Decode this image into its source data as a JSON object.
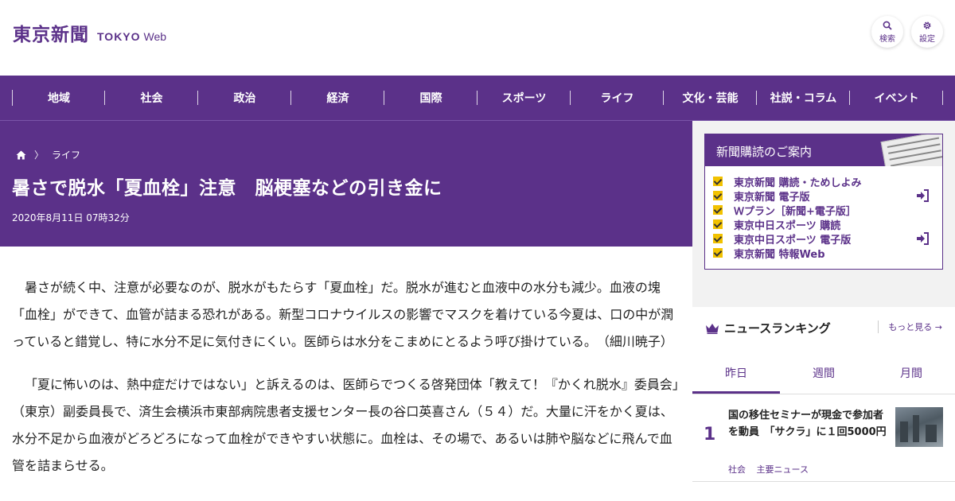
{
  "header": {
    "logo_jp": "東京新聞",
    "logo_en": "TOKYO",
    "logo_web": "Web",
    "search_label": "検索",
    "settings_label": "設定"
  },
  "nav": {
    "items": [
      "地域",
      "社会",
      "政治",
      "経済",
      "国際",
      "スポーツ",
      "ライフ",
      "文化・芸能",
      "社説・コラム",
      "イベント"
    ]
  },
  "article": {
    "breadcrumb": "ライフ",
    "title": "暑さで脱水「夏血栓」注意　脳梗塞などの引き金に",
    "date": "2020年8月11日 07時32分",
    "paragraphs": [
      "暑さが続く中、注意が必要なのが、脱水がもたらす「夏血栓」だ。脱水が進むと血液中の水分も減少。血液の塊「血栓」ができて、血管が詰まる恐れがある。新型コロナウイルスの影響でマスクを着けている今夏は、口の中が潤っていると錯覚し、特に水分不足に気付きにくい。医師らは水分をこまめにとるよう呼び掛けている。　（細川暁子）",
      "「夏に怖いのは、熱中症だけではない」と訴えるのは、医師らでつくる啓発団体「教えて！『かくれ脱水』委員会」（東京）副委員長で、済生会横浜市東部病院患者支援センター長の谷口英喜さん（５４）だ。大量に汗をかく夏は、水分不足から血液がどろどろになって血栓ができやすい状態に。血栓は、その場で、あるいは肺や脳などに飛んで血管を詰まらせる。"
    ]
  },
  "subscription": {
    "title": "新聞購読のご案内",
    "items": [
      "東京新聞 購読・ためしよみ",
      "東京新聞 電子版",
      "Ｗプラン［新聞+電子版］",
      "東京中日スポーツ 購読",
      "東京中日スポーツ 電子版",
      "東京新聞 特報Web"
    ]
  },
  "ranking": {
    "title": "ニュースランキング",
    "more_label": "もっと見る",
    "tabs": [
      "昨日",
      "週間",
      "月間"
    ],
    "items": [
      {
        "rank": "1",
        "title": "国の移住セミナーが現金で参加者を動員　「サクラ」に１回5000円",
        "tags": [
          "社会",
          "主要ニュース"
        ]
      }
    ]
  },
  "colors": {
    "brand_purple": "#5b3189",
    "checkbox_yellow": "#f2c200",
    "sidebar_bg": "#f2f2f2"
  }
}
